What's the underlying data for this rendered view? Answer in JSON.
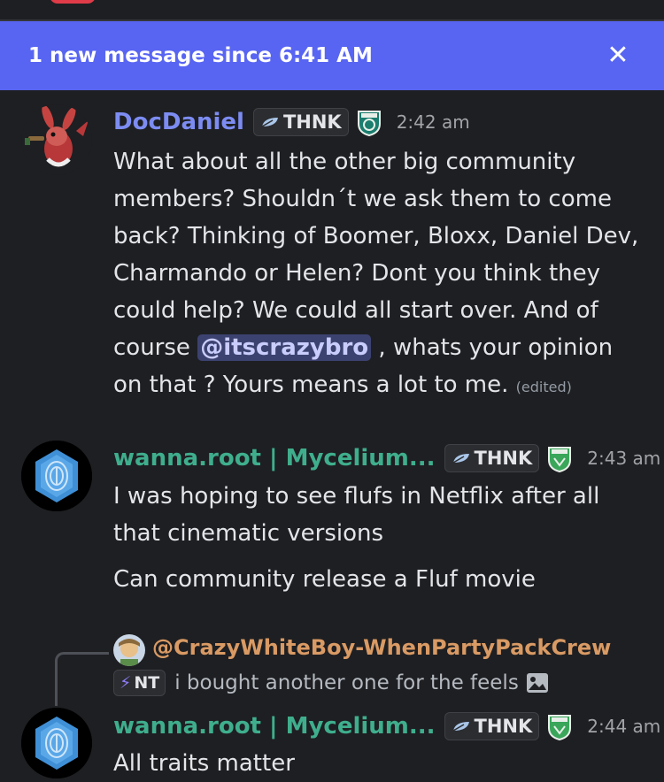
{
  "banner": {
    "text": "1 new message since 6:41 AM",
    "close_icon": "x-icon"
  },
  "messages": [
    {
      "author": "DocDaniel",
      "author_color": "#7c8cf2",
      "tag": "THNK",
      "time": "2:42 am",
      "body_before": "What about all the other big community members? Shouldn´t we ask them to come back? Thinking of Boomer, Bloxx, Daniel Dev, Charmando or Helen? Dont you think they could help? We could all start over. And of course ",
      "mention": "@itscrazybro",
      "body_after": " , whats your opinion on that ? Yours means a lot to me.",
      "edited": "(edited)"
    },
    {
      "author": "wanna.root | Mycelium...",
      "author_color": "#3fae8c",
      "tag": "THNK",
      "time": "2:43 am",
      "lines": [
        "I was hoping to see flufs in Netflix after all that cinematic versions",
        "Can community release a Fluf movie"
      ]
    },
    {
      "reply_to": "@CrazyWhiteBoy-WhenPartyPackCrew",
      "reply_tag": "NT",
      "reply_text": "i bought another one for the feels",
      "author": "wanna.root | Mycelium...",
      "author_color": "#3fae8c",
      "tag": "THNK",
      "time": "2:44 am",
      "partial_text": "All traits matter"
    }
  ]
}
